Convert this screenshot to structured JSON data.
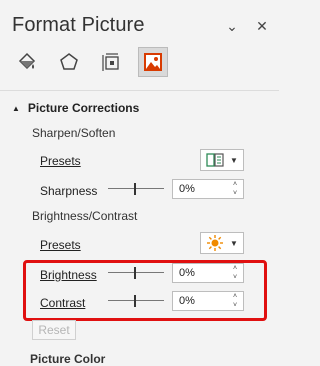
{
  "pane": {
    "title": "Format Picture",
    "collapse_glyph": "⌄",
    "close_glyph": "✕"
  },
  "tabs": [
    {
      "name": "Fill & Line",
      "icon": "fill-bucket-icon"
    },
    {
      "name": "Effects",
      "icon": "pentagon-icon"
    },
    {
      "name": "Size & Properties",
      "icon": "size-properties-icon"
    },
    {
      "name": "Picture",
      "icon": "picture-icon",
      "active": true
    }
  ],
  "section": {
    "title": "Picture Corrections",
    "expanded_glyph": "▲"
  },
  "sharpen": {
    "heading": "Sharpen/Soften",
    "presets_label": "Presets",
    "sharpness_label": "Sharpness",
    "sharpness_value": "0%"
  },
  "brightness_contrast": {
    "heading": "Brightness/Contrast",
    "presets_label": "Presets",
    "brightness_label": "Brightness",
    "brightness_value": "0%",
    "contrast_label": "Contrast",
    "contrast_value": "0%"
  },
  "reset_label": "Reset",
  "next_section_label": "Picture Color",
  "colors": {
    "highlight": "#e01010",
    "accent_green": "#2e8b57",
    "sun_orange": "#f08a00",
    "picture_tab_red": "#d83b01"
  }
}
